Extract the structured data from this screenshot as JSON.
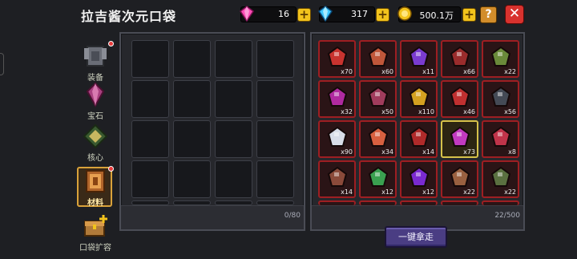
{
  "header": {
    "title": "拉吉酱次元口袋",
    "resources": [
      {
        "name": "pink-gem",
        "value": "16",
        "color": "#ff4fb8"
      },
      {
        "name": "blue-gem",
        "value": "317",
        "color": "#3ec8ff"
      },
      {
        "name": "gold-coin",
        "value": "500.1万",
        "color": "#f2c31c"
      }
    ],
    "help_label": "?",
    "close_label": "✕",
    "plus_label": "+"
  },
  "tabs": [
    {
      "label": "装备",
      "icon": "armor-icon",
      "badge": true,
      "active": false
    },
    {
      "label": "宝石",
      "icon": "gem-icon",
      "badge": false,
      "active": false
    },
    {
      "label": "核心",
      "icon": "core-icon",
      "badge": false,
      "active": false
    },
    {
      "label": "材料",
      "icon": "material-icon",
      "badge": true,
      "active": true
    },
    {
      "label": "口袋扩容",
      "icon": "chest-icon",
      "badge": false,
      "active": false
    }
  ],
  "pocket": {
    "count": "0/80"
  },
  "storage": {
    "count": "22/500",
    "take_all_label": "一键拿走",
    "items": [
      {
        "qty": "x70",
        "color": "#c8332f",
        "icon": "gem-red-icon"
      },
      {
        "qty": "x60",
        "color": "#c0573a",
        "icon": "ore-icon"
      },
      {
        "qty": "x11",
        "color": "#7a3bd0",
        "icon": "potion-icon"
      },
      {
        "qty": "x66",
        "color": "#9a2c2c",
        "icon": "scroll-icon"
      },
      {
        "qty": "x22",
        "color": "#6a8a3a",
        "icon": "herb-icon"
      },
      {
        "qty": "x32",
        "color": "#b02aa0",
        "icon": "feather-icon"
      },
      {
        "qty": "x50",
        "color": "#a03c5c",
        "icon": "shell-icon"
      },
      {
        "qty": "x110",
        "color": "#d4a020",
        "icon": "mask-icon"
      },
      {
        "qty": "x46",
        "color": "#c03030",
        "icon": "fang-icon"
      },
      {
        "qty": "x56",
        "color": "#444a55",
        "icon": "pot-icon"
      },
      {
        "qty": "x90",
        "color": "#d8dde8",
        "icon": "orb-icon"
      },
      {
        "qty": "x34",
        "color": "#d86040",
        "icon": "flame-icon"
      },
      {
        "qty": "x14",
        "color": "#b02a2a",
        "icon": "claw-icon"
      },
      {
        "qty": "x73",
        "color": "#c23ac0",
        "icon": "crystal-icon",
        "selected": true
      },
      {
        "qty": "x8",
        "color": "#c0344a",
        "icon": "horn-icon"
      },
      {
        "qty": "x14",
        "color": "#8a4a3a",
        "icon": "bone-icon"
      },
      {
        "qty": "x12",
        "color": "#3aa050",
        "icon": "leaf-icon"
      },
      {
        "qty": "x12",
        "color": "#7a2ad0",
        "icon": "void-icon"
      },
      {
        "qty": "x22",
        "color": "#9a6040",
        "icon": "gear-icon"
      },
      {
        "qty": "x22",
        "color": "#5a7040",
        "icon": "sword-icon"
      }
    ]
  }
}
